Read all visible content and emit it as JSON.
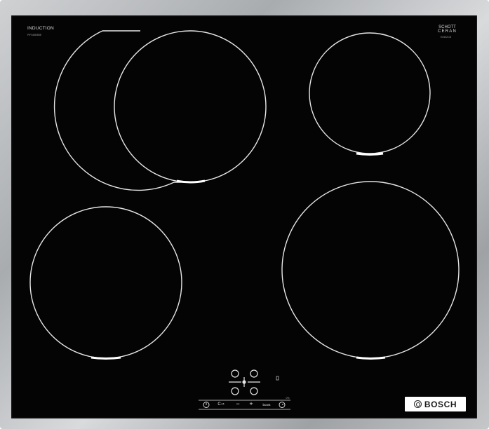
{
  "header": {
    "induction_label": "INDUCTION",
    "model_label": "PIF645BB5E",
    "glass_brand_line1": "SCHOTT",
    "glass_brand_line2": "CERAN",
    "glass_code": "E0402CB"
  },
  "controls": {
    "power_icon": "power-icon",
    "child_lock_icon": "child-lock-icon",
    "minus_label": "−",
    "plus_label": "+",
    "boost_label": "boost",
    "timer_icon": "timer-icon",
    "zone_selector_icon": "zone-selector-icon",
    "small_mark": "0%",
    "indicator_mark": "8"
  },
  "brand": {
    "name": "BOSCH"
  },
  "colors": {
    "glass": "#040404",
    "zone_outline": "#e6e6e6",
    "frame": "#b5b7ba"
  }
}
